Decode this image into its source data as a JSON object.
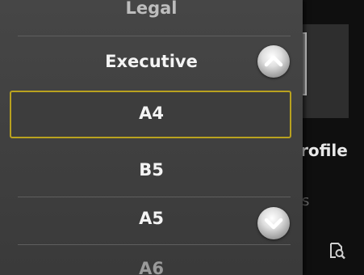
{
  "background": {
    "profile_text": "rofile",
    "faded_text": "s"
  },
  "paper_list": {
    "items": [
      "Legal",
      "Executive",
      "A4",
      "B5",
      "A5",
      "A6"
    ],
    "selected": "A4"
  },
  "icons": {
    "scroll_up": "chevron-up-icon",
    "scroll_down": "chevron-down-icon",
    "preview": "preview-search-icon"
  },
  "colors": {
    "selection_border": "#b9a21f",
    "list_background": "#424242"
  }
}
